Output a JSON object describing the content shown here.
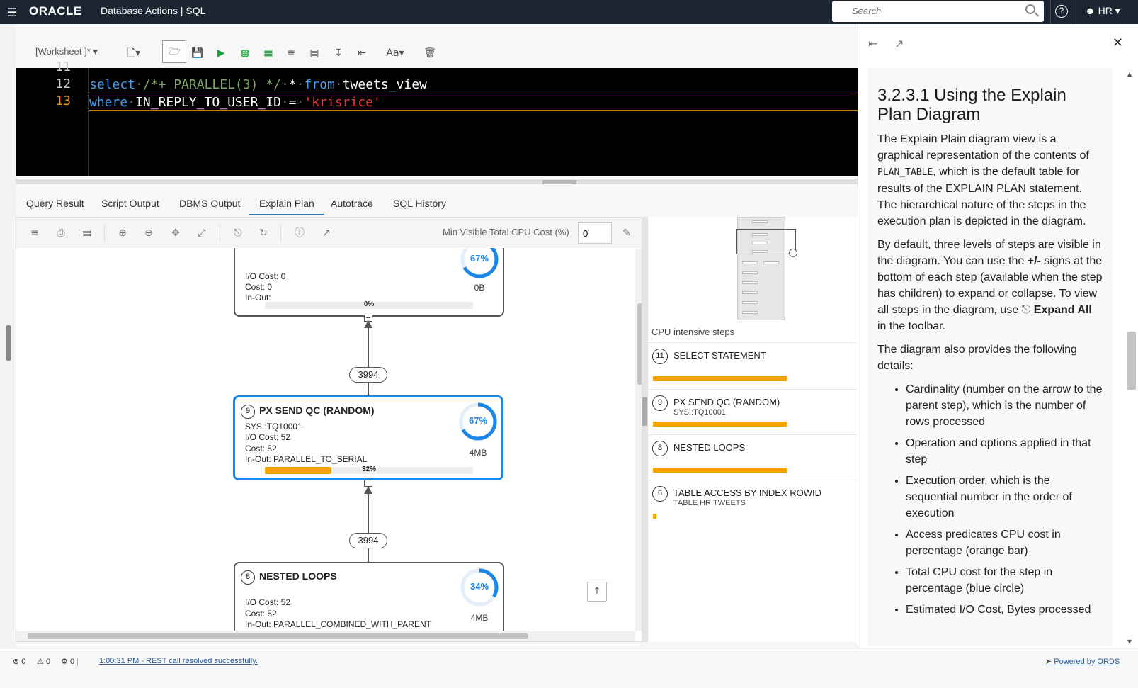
{
  "header": {
    "brand": "ORACLE",
    "app_title": "Database Actions |  SQL",
    "search_placeholder": "Search",
    "help_label": "?",
    "user": "HR"
  },
  "worksheet": {
    "name": "[Worksheet ]*",
    "font_label": "Aa"
  },
  "editor": {
    "lines": [
      {
        "num": "11"
      },
      {
        "num": "12"
      },
      {
        "num": "13"
      }
    ],
    "line12": {
      "kw1": "select",
      "comment": "/*+ PARALLEL(3) */",
      "star": "*",
      "kw2": "from",
      "ident": "tweets_view"
    },
    "line13": {
      "kw1": "where",
      "ident": "IN_REPLY_TO_USER_ID",
      "op": "=",
      "str": "'krisrice'"
    }
  },
  "tabs": [
    "Query Result",
    "Script Output",
    "DBMS Output",
    "Explain Plan",
    "Autotrace",
    "SQL History"
  ],
  "active_tab": "Explain Plan",
  "diagram": {
    "min_cpu_label": "Min Visible Total CPU Cost (%)",
    "min_cpu_value": "0",
    "top_node": {
      "io": "I/O Cost: 0",
      "cost": "Cost: 0",
      "inout": "In-Out:",
      "cpu_pct": "67%",
      "cpu": 0.67,
      "bytes": "0B",
      "bar_pct": "0%",
      "bar": 0.0
    },
    "card1": "3994",
    "node9": {
      "num": "9",
      "title": "PX SEND QC (RANDOM)",
      "obj": "SYS.:TQ10001",
      "io": "I/O Cost: 52",
      "cost": "Cost: 52",
      "inout": "In-Out: PARALLEL_TO_SERIAL",
      "cpu_pct": "67%",
      "cpu": 0.67,
      "bytes": "4MB",
      "bar_pct": "32%",
      "bar": 0.32
    },
    "card2": "3994",
    "node8": {
      "num": "8",
      "title": "NESTED LOOPS",
      "io": "I/O Cost: 52",
      "cost": "Cost: 52",
      "inout": "In-Out: PARALLEL_COMBINED_WITH_PARENT",
      "cpu_pct": "34%",
      "cpu": 0.34,
      "bytes": "4MB"
    }
  },
  "cpu_steps": {
    "title": "CPU intensive steps",
    "items": [
      {
        "num": "11",
        "name": "SELECT STATEMENT",
        "sub": "",
        "share": 1.0
      },
      {
        "num": "9",
        "name": "PX SEND QC (RANDOM)",
        "sub": "SYS.:TQ10001",
        "share": 1.0
      },
      {
        "num": "8",
        "name": "NESTED LOOPS",
        "sub": "",
        "share": 1.0
      },
      {
        "num": "6",
        "name": "TABLE ACCESS BY INDEX ROWID",
        "sub": "TABLE HR.TWEETS",
        "share": 0.02
      }
    ]
  },
  "help": {
    "heading": "3.2.3.1 Using the Explain Plan Diagram",
    "p1a": "The Explain Plain diagram view is a graphical representation of the contents of ",
    "p1code": "PLAN_TABLE",
    "p1b": ", which is the default table for results of the EXPLAIN PLAN statement. The hierarchical nature of the steps in the execution plan is depicted in the diagram.",
    "p2a": "By default, three levels of steps are visible in the diagram. You can use the ",
    "p2bold": "+/-",
    "p2b": " signs at the bottom of each step (available when the step has children) to expand or collapse. To view all steps in the diagram, use ",
    "p2bold2": "Expand All",
    "p2c": " in the toolbar.",
    "p3": "The diagram also provides the following details:",
    "bullets": [
      "Cardinality (number on the arrow to the parent step), which is the number of rows processed",
      "Operation and options applied in that step",
      "Execution order, which is the sequential number in the order of execution",
      "Access predicates CPU cost in percentage (orange bar)",
      "Total CPU cost for the step in percentage (blue circle)",
      "Estimated I/O Cost, Bytes processed"
    ]
  },
  "status": {
    "errors": "0",
    "warnings": "0",
    "jobs": "0",
    "message": "1:00:31 PM - REST call resolved successfully.",
    "powered": "Powered by ORDS"
  },
  "colors": {
    "accent": "#1a86e8",
    "cpu_bar": "#f5a100",
    "header_bg": "#1c2633"
  }
}
